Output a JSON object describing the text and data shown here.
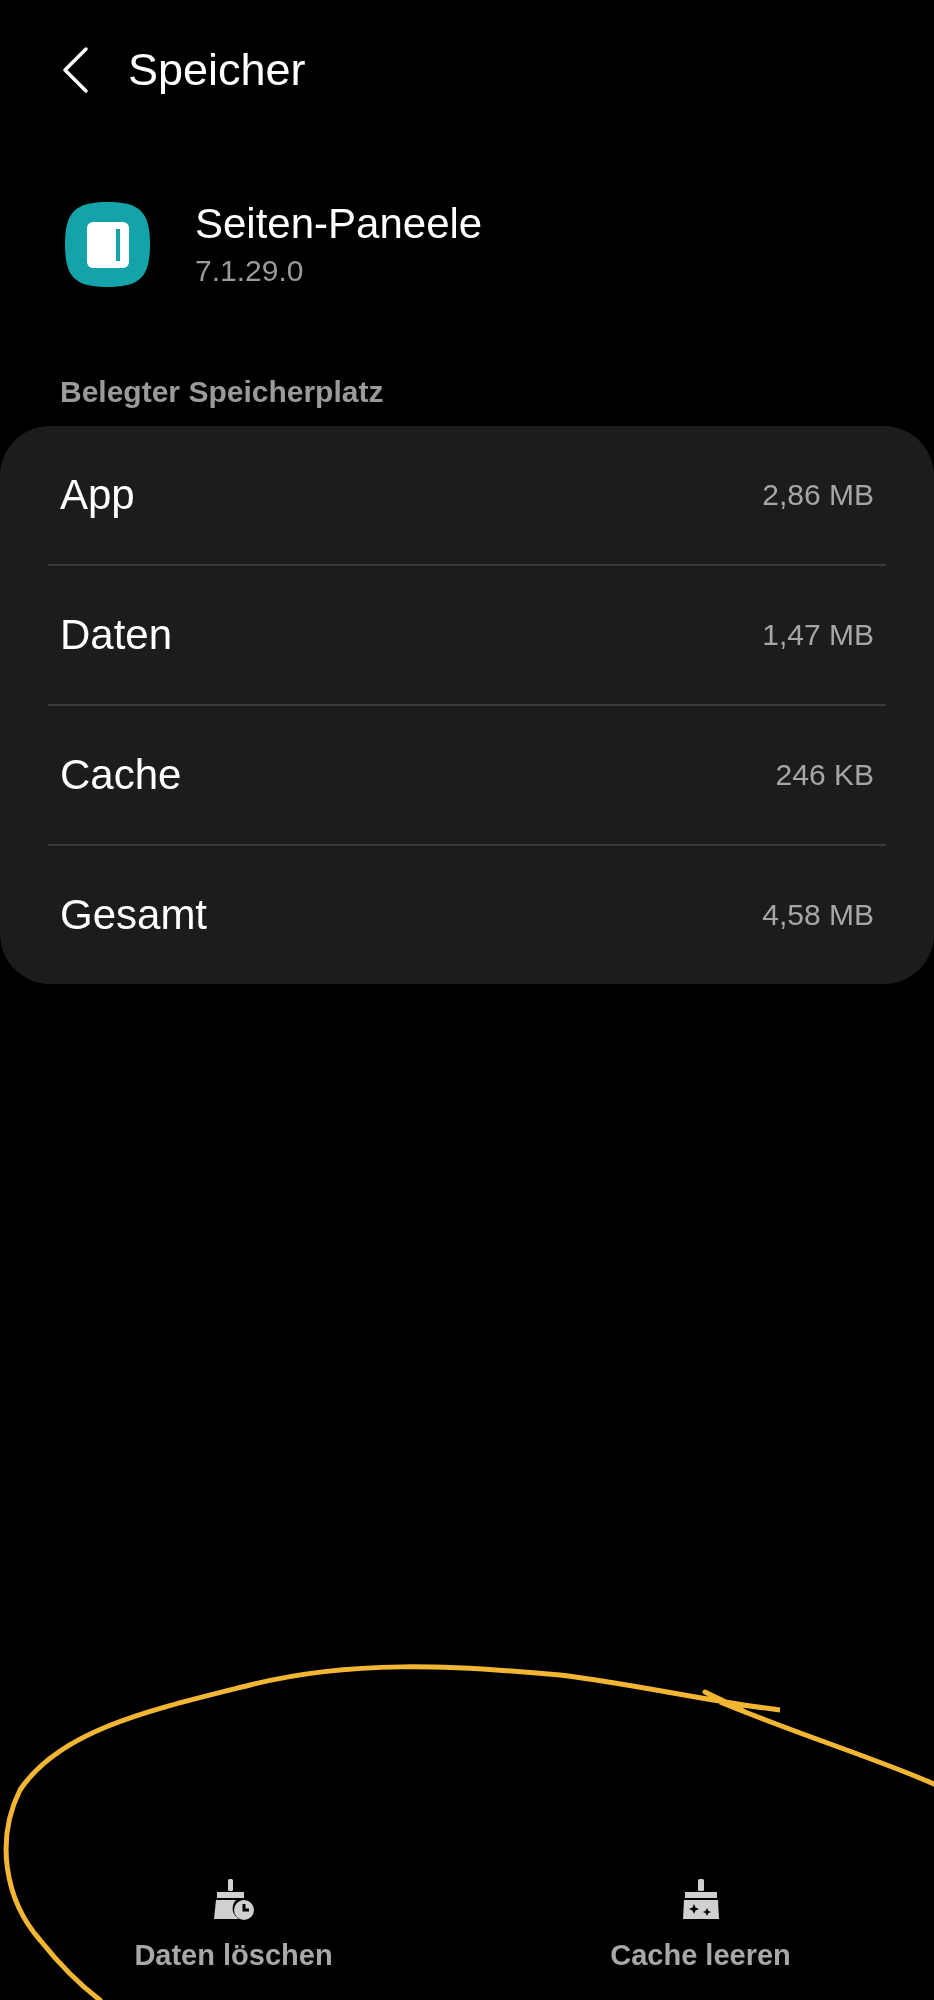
{
  "header": {
    "title": "Speicher"
  },
  "app": {
    "name": "Seiten-Paneele",
    "version": "7.1.29.0"
  },
  "section_title": "Belegter Speicherplatz",
  "storage_rows": [
    {
      "label": "App",
      "value": "2,86 MB"
    },
    {
      "label": "Daten",
      "value": "1,47 MB"
    },
    {
      "label": "Cache",
      "value": "246 KB"
    },
    {
      "label": "Gesamt",
      "value": "4,58 MB"
    }
  ],
  "actions": [
    {
      "label": "Daten löschen",
      "kind": "clear-data"
    },
    {
      "label": "Cache leeren",
      "kind": "clear-cache"
    }
  ],
  "annotation": {
    "kind": "loop"
  }
}
